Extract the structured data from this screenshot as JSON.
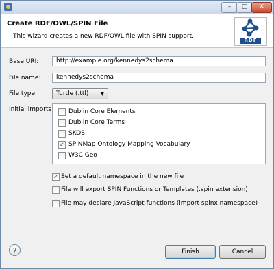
{
  "window": {
    "minimize_glyph": "–",
    "maximize_glyph": "□",
    "close_glyph": "✕"
  },
  "header": {
    "title": "Create RDF/OWL/SPIN File",
    "description": "This wizard creates a new RDF/OWL file with SPIN support.",
    "logo_text": "RDF"
  },
  "form": {
    "base_uri_label": "Base URI:",
    "base_uri_value": "http://example.org/kennedys2schema",
    "file_name_label": "File name:",
    "file_name_value": "kennedys2schema",
    "file_type_label": "File type:",
    "file_type_value": "Turtle (.ttl)",
    "initial_imports_label": "Initial imports:"
  },
  "imports": [
    {
      "label": "Dublin Core Elements",
      "checked": false
    },
    {
      "label": "Dublin Core Terms",
      "checked": false
    },
    {
      "label": "SKOS",
      "checked": false
    },
    {
      "label": "SPINMap Ontology Mapping Vocabulary",
      "checked": true
    },
    {
      "label": "W3C Geo",
      "checked": false
    }
  ],
  "options": [
    {
      "label": "Set a default namespace in the new file",
      "checked": true
    },
    {
      "label": "File will export SPIN Functions or Templates (.spin extension)",
      "checked": false
    },
    {
      "label": "File may declare JavaScript functions (import spinx namespace)",
      "checked": false
    }
  ],
  "footer": {
    "help_glyph": "?",
    "finish_label": "Finish",
    "cancel_label": "Cancel"
  },
  "check_glyph": "✓"
}
